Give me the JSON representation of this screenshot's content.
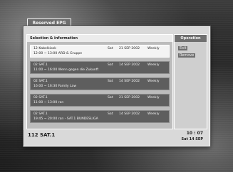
{
  "window": {
    "title": "Reserved EPG"
  },
  "list": {
    "header": "Selection & information",
    "entries": [
      {
        "num": "12",
        "channel": "Kabelkiosk",
        "day": "Sat",
        "date": "21 SEP 2002",
        "mode": "Weekly",
        "time_title": "12:00 ~ 13:00  ARD & Gruppe"
      },
      {
        "num": "02",
        "channel": "SAT.1",
        "day": "Sat",
        "date": "14 SEP 2002",
        "mode": "Weekly",
        "time_title": "11:00 ~ 16:00  Wenn gegen die Zukunft"
      },
      {
        "num": "02",
        "channel": "SAT.1",
        "day": "Sat",
        "date": "14 SEP 2002",
        "mode": "Weekly",
        "time_title": "16:00 ~ 16:30  Family Law"
      },
      {
        "num": "02",
        "channel": "SAT.1",
        "day": "Sat",
        "date": "21 SEP 2002",
        "mode": "Weekly",
        "time_title": "11:00 ~ 13:00  ran"
      },
      {
        "num": "02",
        "channel": "SAT.1",
        "day": "Sat",
        "date": "14 SEP 2002",
        "mode": "Weekly",
        "time_title": "19:45 ~ 20:00  ran - SAT.1 BUNDESLIGA"
      }
    ]
  },
  "side": {
    "header": "Operation",
    "items": [
      "Exit",
      "Remove"
    ]
  },
  "footer": {
    "channel": "112   SAT.1",
    "time": "10 : 07",
    "date": "Sat 14 SEP"
  }
}
